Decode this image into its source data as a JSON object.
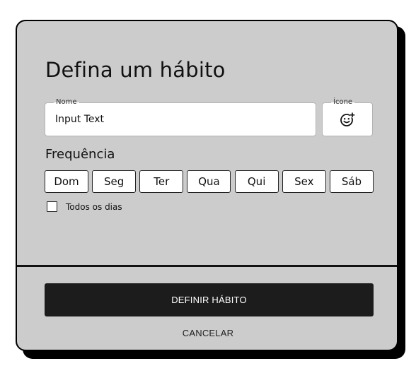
{
  "dialog": {
    "title": "Defina um hábito",
    "name_field": {
      "label": "Nome",
      "value": "Input Text"
    },
    "icon_field": {
      "label": "Ícone",
      "icon": "add-emoji-icon"
    },
    "frequency": {
      "title": "Frequência",
      "days": [
        "Dom",
        "Seg",
        "Ter",
        "Qua",
        "Qui",
        "Sex",
        "Sáb"
      ],
      "all_days_label": "Todos os dias",
      "all_days_checked": false
    },
    "actions": {
      "confirm_label": "DEFINIR HÁBITO",
      "cancel_label": "CANCELAR"
    }
  },
  "colors": {
    "card_background": "#cccccc",
    "border": "#000000",
    "primary_button": "#1c1c1c",
    "primary_button_text": "#ffffff"
  }
}
